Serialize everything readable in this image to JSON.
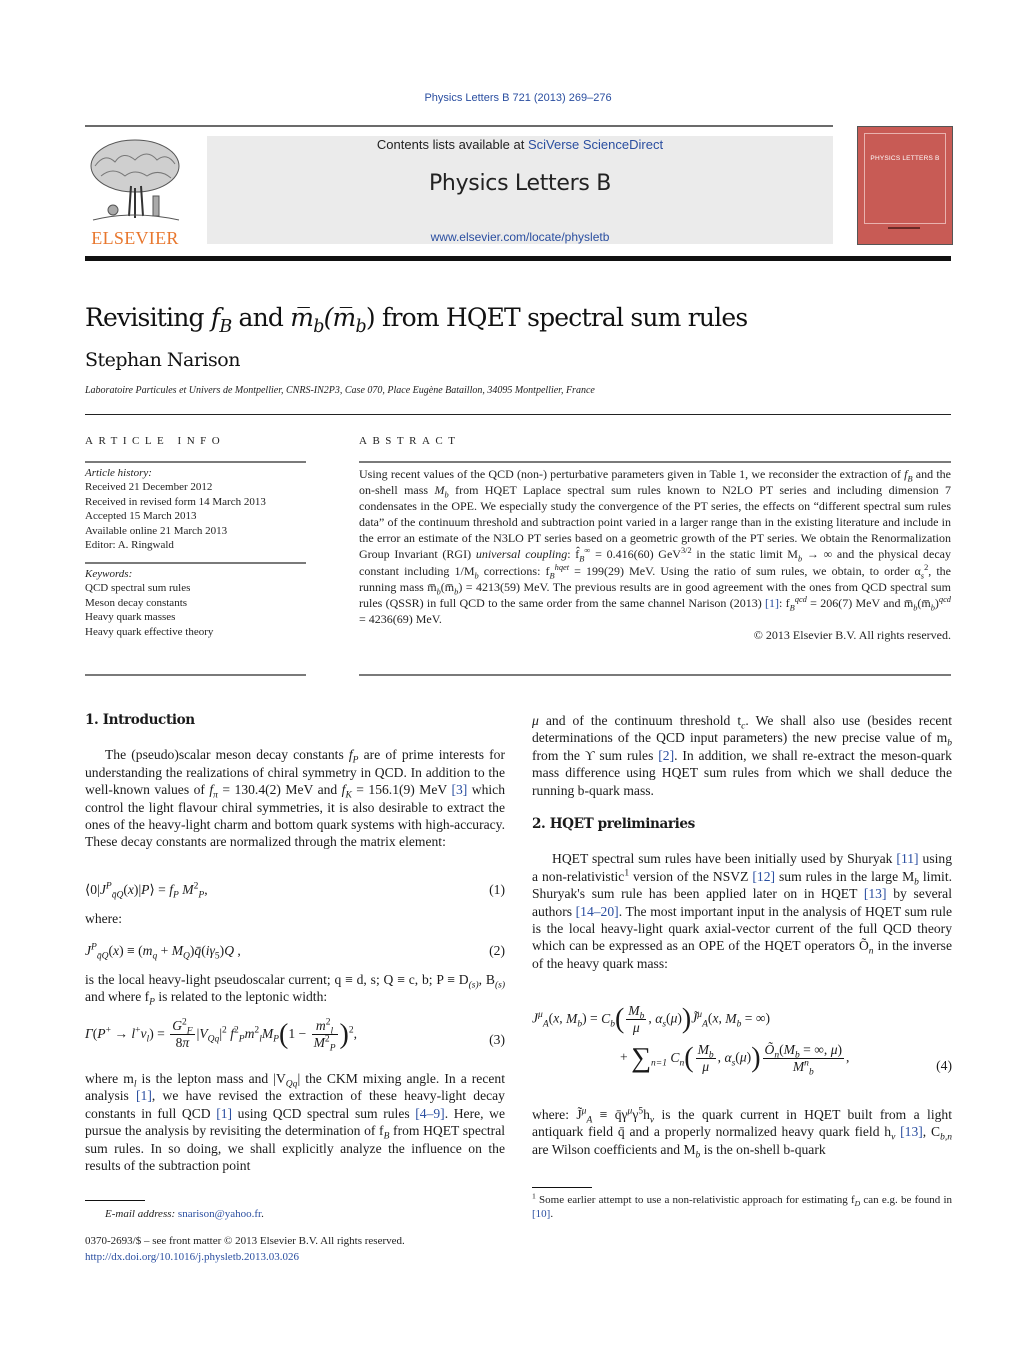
{
  "header": {
    "citation": "Physics Letters B 721 (2013) 269–276",
    "contents_prefix": "Contents lists available at ",
    "contents_link": "SciVerse ScienceDirect",
    "journal_title": "Physics Letters B",
    "journal_url": "www.elsevier.com/locate/physletb",
    "publisher_logo": "ELSEVIER",
    "cover_title": "PHYSICS LETTERS B"
  },
  "article": {
    "title_pre": "Revisiting ",
    "title_fb": "f",
    "title_fb_sub": "B",
    "title_mid": " and ",
    "title_mb": "m̅",
    "title_mb_sub": "b",
    "title_paren": "(m̅",
    "title_paren_sub": "b",
    "title_close": ")",
    "title_post": " from HQET spectral sum rules",
    "author": "Stephan Narison",
    "affiliation": "Laboratoire Particules et Univers de Montpellier, CNRS-IN2P3, Case 070, Place Eugène Bataillon, 34095 Montpellier, France"
  },
  "article_info": {
    "heading": "ARTICLE INFO",
    "history_label": "Article history:",
    "history": [
      "Received 21 December 2012",
      "Received in revised form 14 March 2013",
      "Accepted 15 March 2013",
      "Available online 21 March 2013",
      "Editor: A. Ringwald"
    ],
    "keywords_label": "Keywords:",
    "keywords": [
      "QCD spectral sum rules",
      "Meson decay constants",
      "Heavy quark masses",
      "Heavy quark effective theory"
    ]
  },
  "abstract": {
    "heading": "ABSTRACT",
    "p1": "Using recent values of the QCD (non-) perturbative parameters given in Table 1, we reconsider the extraction of ",
    "p2": " and the on-shell mass ",
    "p3": " from HQET Laplace spectral sum rules known to N2LO PT series and including dimension 7 condensates in the OPE. We especially study the convergence of the PT series, the effects on “different spectral sum rules data” of the continuum threshold and subtraction point varied in a larger range than in the existing literature and include in the error an estimate of the N3LO PT series based on a geometric growth of the PT series. We obtain the Renormalization Group Invariant (RGI) ",
    "universal_coupling": "universal coupling",
    "p4": ": f̂",
    "p4_val": " = 0.416(60) GeV",
    "p4_exp": "3/2",
    "p5": " in the static limit M",
    "p5b": " → ∞ and the physical decay constant including 1/M",
    "p6": " corrections: f",
    "p6_sup": "hqet",
    "p6_val": " = 199(29) MeV. Using the ratio of sum rules, we obtain, to order α",
    "p7": ", the running mass m̅",
    "p7b": "(m̅",
    "p7c": ") = 4213(59) MeV. The previous results are in good agreement with the ones from QCD spectral sum rules (QSSR) in full QCD to the same order from the same channel Narison (2013) ",
    "ref1": "[1]",
    "p8": ": f",
    "p8_sup": "qcd",
    "p8_val": " = 206(7) MeV and m̅",
    "p8b": "(m̅",
    "p8c": ")",
    "p8d_sup": "qcd",
    "p8e": " = 4236(69) MeV.",
    "copyright": "© 2013 Elsevier B.V. All rights reserved."
  },
  "intro": {
    "heading": "1.  Introduction",
    "para1_a": "The (pseudo)scalar meson decay constants ",
    "para1_b": " are of prime interests for understanding the realizations of chiral symmetry in QCD. In addition to the well-known values of ",
    "para1_c": " = 130.4(2) MeV and ",
    "para1_d": " = 156.1(9) MeV ",
    "ref3": "[3]",
    "para1_e": " which control the light flavour chiral symmetries, it is also desirable to extract the ones of the heavy-light charm and bottom quark systems with high-accuracy. These decay constants are normalized through the matrix element:",
    "eq1_num": "(1)",
    "where": "where:",
    "eq2_num": "(2)",
    "para2_a": "is the local heavy-light pseudoscalar current; q ≡ d, s;  Q ≡ c, b; P ≡ D",
    "para2_b": ", B",
    "para2_c": " and where f",
    "para2_d": " is related to the leptonic width:",
    "eq3_num": "(3)",
    "para3_a": "where m",
    "para3_b": " is the lepton mass and |V",
    "para3_c": "| the CKM mixing angle. In a recent analysis ",
    "ref1a": "[1]",
    "para3_d": ", we have revised the extraction of these heavy-light decay constants in full QCD ",
    "ref1b": "[1]",
    "para3_e": " using QCD spectral sum rules ",
    "ref49": "[4–9]",
    "para3_f": ". Here, we pursue the analysis by revisiting the determination of f",
    "para3_g": " from HQET spectral sum rules. In so doing, we shall explicitly analyze the influence on the results of the subtraction point"
  },
  "right_col": {
    "para_a": " and of the continuum threshold t",
    "para_b": ". We shall also use (besides recent determinations of the QCD input parameters) the new precise value of m",
    "para_c": " from the ϒ sum rules ",
    "ref2": "[2]",
    "para_d": ". In addition, we shall re-extract the meson-quark mass difference using HQET sum rules from which we shall deduce the running b-quark mass.",
    "sec2_heading": "2.  HQET preliminaries",
    "sec2_a": "HQET spectral sum rules have been initially used by Shuryak ",
    "ref11": "[11]",
    "sec2_b": " using a non-relativistic",
    "sec2_fn": "1",
    "sec2_c": " version of the NSVZ ",
    "ref12": "[12]",
    "sec2_d": " sum rules in the large M",
    "sec2_e": " limit. Shuryak's sum rule has been applied later on in HQET ",
    "ref13": "[13]",
    "sec2_f": " by several authors ",
    "ref1420": "[14–20]",
    "sec2_g": ". The most important input in the analysis of HQET sum rule is the local heavy-light quark axial-vector current of the full QCD theory which can be expressed as an OPE of the HQET operators Õ",
    "sec2_h": " in the inverse of the heavy quark mass:",
    "eq4_num": "(4)",
    "where_a": "where: J̃",
    "where_b": " ≡ q̄γ",
    "where_c": "γ",
    "where_d": "h",
    "where_e": " is the quark current in HQET built from a light antiquark field q̄ and a properly normalized heavy quark field h",
    "ref13b": "[13]",
    "where_f": ", C",
    "where_g": " are Wilson coefficients and M",
    "where_h": " is the on-shell b-quark"
  },
  "footnotes": {
    "email_label": "E-mail address: ",
    "email": "snarison@yahoo.fr",
    "front_matter": "0370-2693/$ – see front matter  © 2013 Elsevier B.V. All rights reserved.",
    "doi": "http://dx.doi.org/10.1016/j.physletb.2013.03.026",
    "fn1_mark": "1",
    "fn1_a": " Some earlier attempt to use a non-relativistic approach for estimating f",
    "fn1_b": " can e.g. be found in ",
    "ref10": "[10]"
  }
}
